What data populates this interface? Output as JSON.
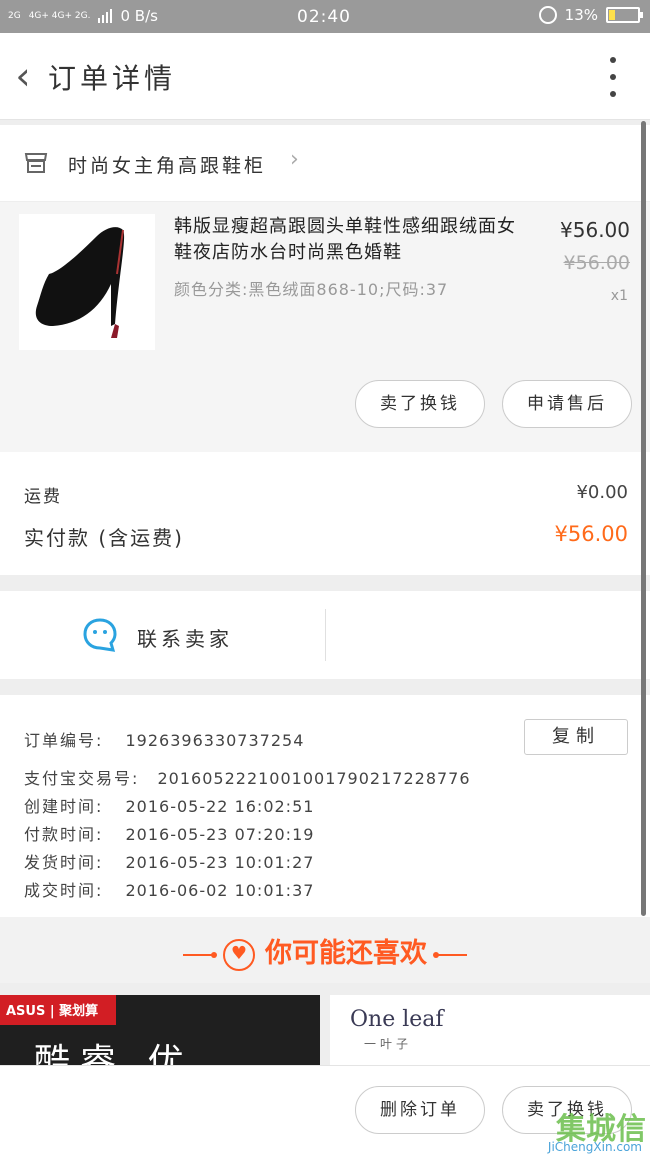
{
  "status_bar": {
    "network": "2G",
    "network2": "4G+ 4G+ 2G.",
    "speed": "0 B/s",
    "time": "02:40",
    "battery": "13%"
  },
  "header": {
    "title": "订单详情",
    "back_icon": "chevron-left-icon",
    "more_icon": "more-vertical-icon"
  },
  "shop": {
    "name": "时尚女主角高跟鞋柜",
    "icon": "store-icon",
    "chevron": "›"
  },
  "product": {
    "title": "韩版显瘦超高跟圆头单鞋性感细跟绒面女鞋夜店防水台时尚黑色婚鞋",
    "spec": "颜色分类:黑色绒面868-10;尺码:37",
    "price": "¥56.00",
    "original_price": "¥56.00",
    "quantity": "x1",
    "buttons": {
      "refund": "卖了换钱",
      "aftersale": "申请售后"
    }
  },
  "fees": {
    "shipping_label": "运费",
    "shipping_value": "¥0.00",
    "paid_label": "实付款 (含运费)",
    "paid_value": "¥56.00",
    "paid_color": "#ff6a1a"
  },
  "contact": {
    "label": "联系卖家",
    "icon": "chat-bubble-icon"
  },
  "order_info": {
    "order_no_label": "订单编号:",
    "order_no": "1926396330737254",
    "copy_label": "复制",
    "alipay_label": "支付宝交易号:",
    "alipay_no": "2016052221001001790217228776",
    "created_label": "创建时间:",
    "created": "2016-05-22 16:02:51",
    "paid_label": "付款时间:",
    "paid": "2016-05-23 07:20:19",
    "shipped_label": "发货时间:",
    "shipped": "2016-05-23 10:01:27",
    "completed_label": "成交时间:",
    "completed": "2016-06-02 10:01:37"
  },
  "recommend": {
    "title": "你可能还喜欢",
    "accent": "#ff5a22"
  },
  "ads": {
    "left_brand": "ASUS | 聚划算",
    "left_text": "酷睿 优",
    "right_brand": "One leaf",
    "right_sub": "一叶子"
  },
  "bottom": {
    "delete_label": "删除订单",
    "refund_label": "卖了换钱"
  },
  "watermark": {
    "text": "集城信",
    "sub": "JiChengXin.com"
  }
}
